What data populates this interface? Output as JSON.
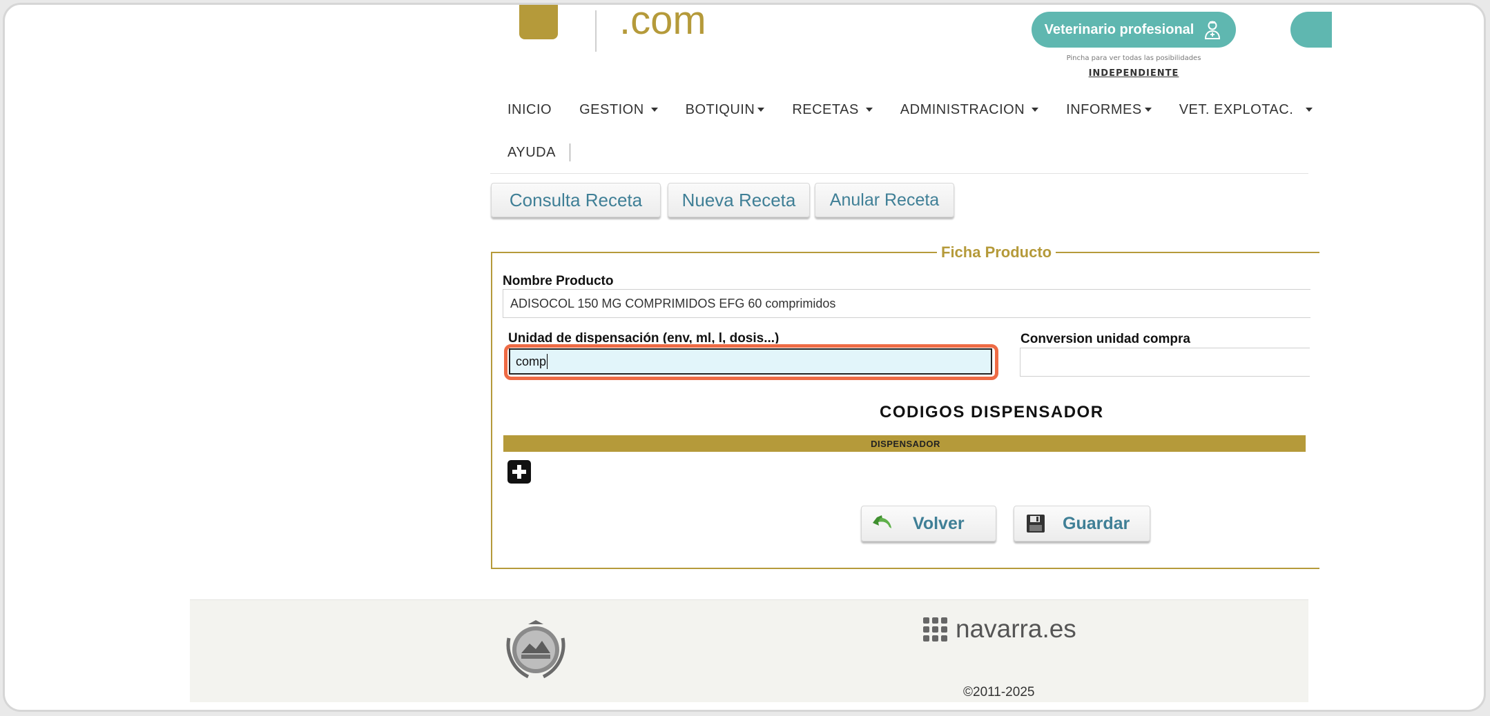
{
  "header": {
    "logo_suffix": ".com",
    "vet_button_label": "Veterinario profesional",
    "vet_hint": "Pincha para ver todas las posibilidades",
    "vet_type": "INDEPENDIENTE"
  },
  "menu": {
    "row1": [
      {
        "label": "INICIO",
        "caret": false
      },
      {
        "label": "GESTION",
        "caret": true
      },
      {
        "label": "BOTIQUIN",
        "caret": true
      },
      {
        "label": "RECETAS",
        "caret": true
      },
      {
        "label": "ADMINISTRACION",
        "caret": true
      },
      {
        "label": "INFORMES",
        "caret": true
      },
      {
        "label": "VET. EXPLOTAC.",
        "caret": true
      }
    ],
    "row2": [
      {
        "label": "AYUDA",
        "caret": false
      }
    ]
  },
  "tabs": {
    "consulta": "Consulta Receta",
    "nueva": "Nueva Receta",
    "anular": "Anular Receta"
  },
  "ficha": {
    "legend": "Ficha Producto",
    "nombre_label": "Nombre Producto",
    "nombre_value": "ADISOCOL 150 MG COMPRIMIDOS EFG  60 comprimidos",
    "unidad_label": "Unidad de dispensación (env, ml, l, dosis...)",
    "unidad_value": "comp",
    "conversion_label": "Conversion unidad compra",
    "conversion_value": "",
    "codigos_title": "CODIGOS DISPENSADOR",
    "dispensador_header": "DISPENSADOR"
  },
  "actions": {
    "volver": "Volver",
    "guardar": "Guardar"
  },
  "footer": {
    "brand": "navarra.es",
    "copyright": "©2011-2025"
  },
  "colors": {
    "gold": "#b59a3a",
    "teal": "#5fb7b0",
    "link_blue": "#3f7f96",
    "highlight": "#ee6b45"
  }
}
